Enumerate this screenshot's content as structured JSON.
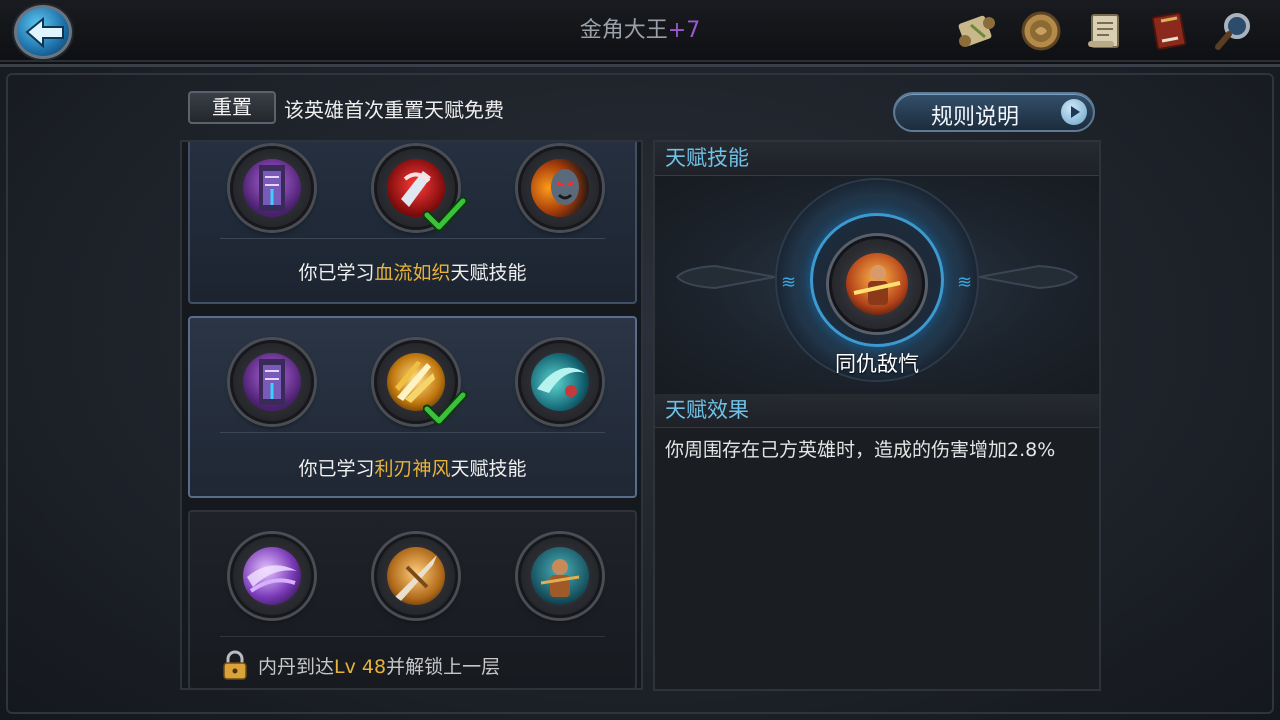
{
  "header": {
    "title": "金角大王",
    "title_plus": "+7",
    "icons": [
      "scroll-icon",
      "coin-medal-icon",
      "parchment-icon",
      "book-icon",
      "magnifier-icon"
    ]
  },
  "toolbar": {
    "reset_label": "重置",
    "reset_note": "该英雄首次重置天赋免费",
    "rules_label": "规则说明"
  },
  "tiers": [
    {
      "skills": [
        "purple-totem-skill-icon",
        "blood-blade-skill-icon",
        "vampire-lord-skill-icon"
      ],
      "learned_index": 1,
      "text_prefix": "你已学习",
      "highlight": "血流如织",
      "text_suffix": "天赋技能"
    },
    {
      "skills": [
        "purple-totem-skill-icon",
        "golden-blades-skill-icon",
        "teal-slash-skill-icon"
      ],
      "learned_index": 1,
      "text_prefix": "你已学习",
      "highlight": "利刃神风",
      "text_suffix": "天赋技能"
    },
    {
      "skills": [
        "purple-wind-skill-icon",
        "spear-thrust-skill-icon",
        "monk-ally-skill-icon"
      ],
      "locked": true,
      "lock_prefix": "内丹到达",
      "lock_level": "Lv 48",
      "lock_suffix": "并解锁上一层"
    }
  ],
  "detail": {
    "skill_heading": "天赋技能",
    "skill_name": "同仇敌忾",
    "effect_heading": "天赋效果",
    "effect_text": "你周围存在己方英雄时，造成的伤害增加2.8%"
  },
  "colors": {
    "highlight": "#e7b33a",
    "section_heading": "#6fc1e6",
    "accent_blue": "#3d9ad0",
    "check_green": "#39c23a",
    "title_plus": "#9b59d0"
  }
}
